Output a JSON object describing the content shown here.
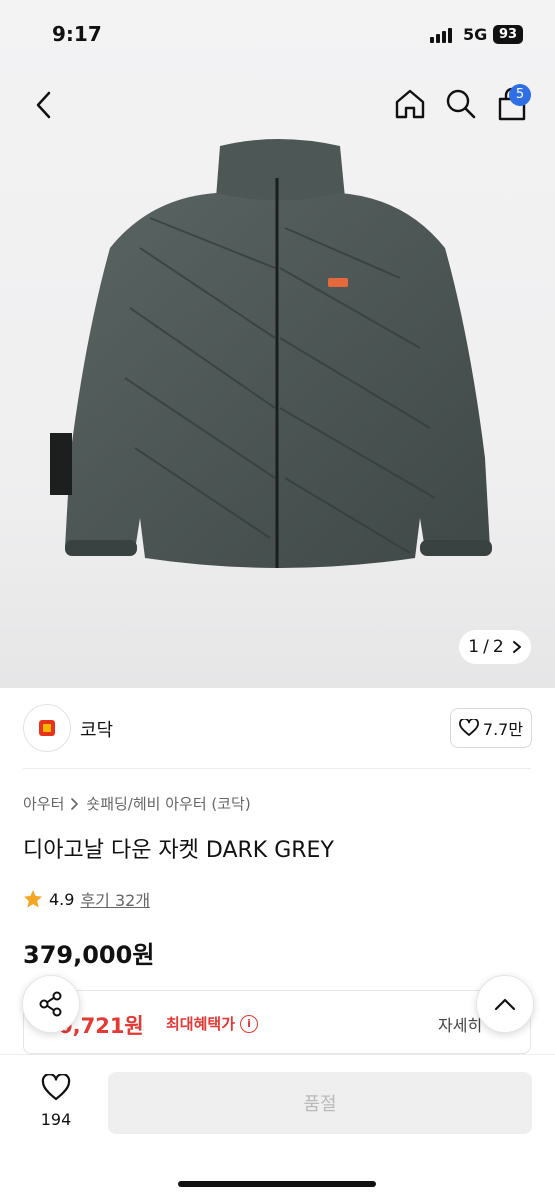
{
  "status_bar": {
    "time": "9:17",
    "network": "5G",
    "battery": "93"
  },
  "header": {
    "cart_count": "5"
  },
  "gallery": {
    "current": "1",
    "separator": "/",
    "total": "2",
    "product_color": "#4b5553"
  },
  "brand": {
    "name": "코닥",
    "likes": "7.7만"
  },
  "product": {
    "category_parent": "아우터",
    "category_child": "숏패딩/헤비 아우터 (코닥)",
    "title": "디아고날 다운 자켓 DARK GREY",
    "rating": "4.9",
    "reviews": "후기 32개",
    "price": "379,000원"
  },
  "benefit": {
    "price": "0,721원",
    "label": "최대혜택가",
    "info_icon": "i",
    "detail_link": "자세히",
    "accent_color": "#e53935"
  },
  "bottom_bar": {
    "wish_count": "194",
    "cta_label": "품절"
  }
}
